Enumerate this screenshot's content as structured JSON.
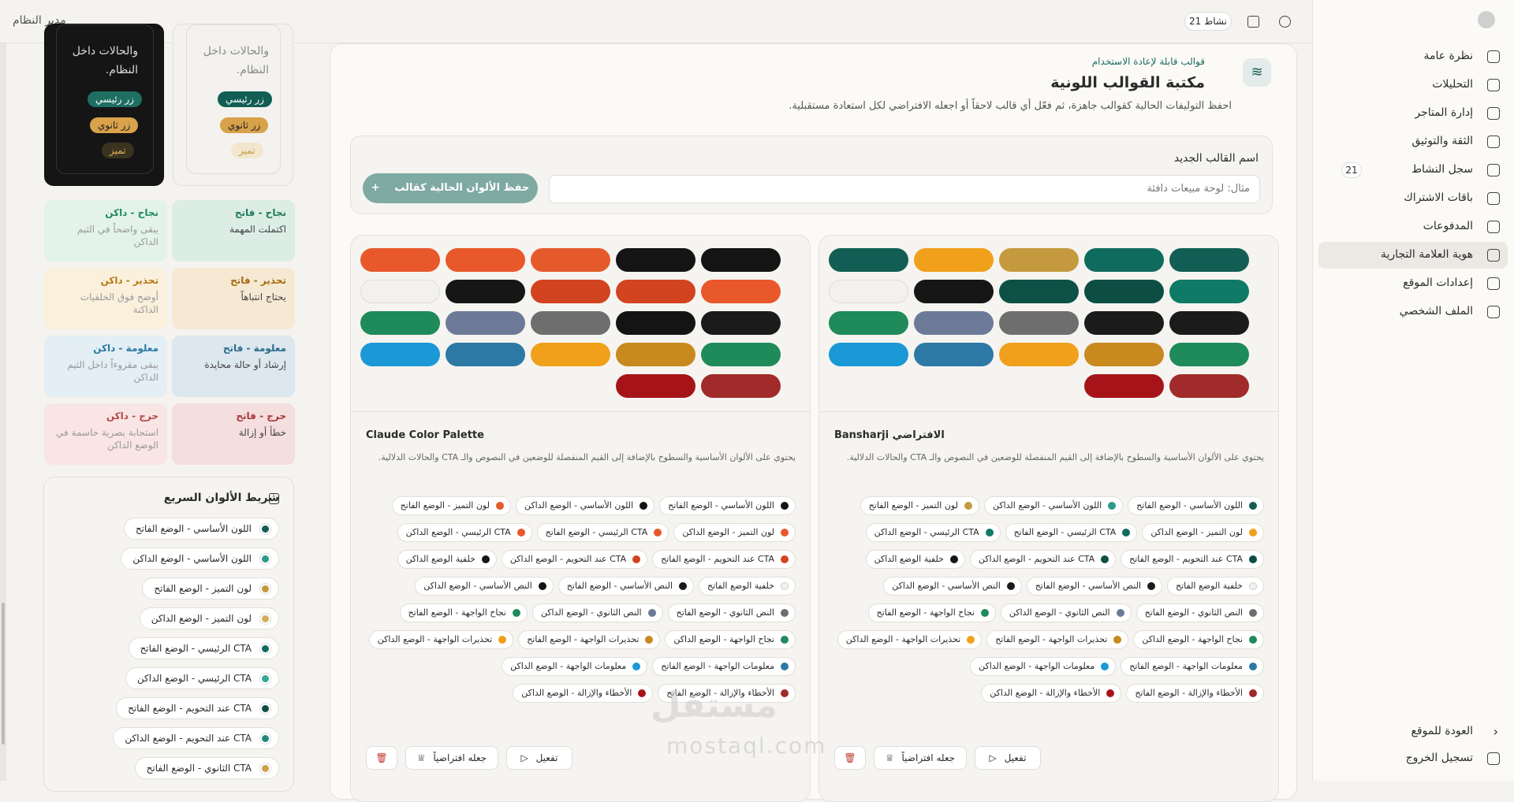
{
  "sidebar": {
    "items": [
      {
        "label": "نظرة عامة",
        "icon": "grid-icon"
      },
      {
        "label": "التحليلات",
        "icon": "chart-icon"
      },
      {
        "label": "إدارة المتاجر",
        "icon": "store-icon"
      },
      {
        "label": "الثقة والتوثيق",
        "icon": "shield-icon"
      },
      {
        "label": "سجل النشاط",
        "icon": "history-icon",
        "badge": "21"
      },
      {
        "label": "باقات الاشتراك",
        "icon": "card-icon"
      },
      {
        "label": "المدفوعات",
        "icon": "payments-icon"
      },
      {
        "label": "هوية العلامة التجارية",
        "icon": "gear-icon",
        "active": true
      },
      {
        "label": "إعدادات الموقع",
        "icon": "gear-icon"
      },
      {
        "label": "الملف الشخصي",
        "icon": "user-icon"
      }
    ],
    "back_label": "العودة للموقع",
    "logout_label": "تسجيل الخروج"
  },
  "topbar": {
    "title": "مدير النظام",
    "activity": "نشاط 21"
  },
  "preview": {
    "cards": [
      {
        "text": "والحالات داخل النظام.",
        "primary": "زر رئيسي",
        "secondary": "زر ثانوي",
        "accent": "تميز"
      },
      {
        "text": "والحالات داخل النظام.",
        "primary": "زر رئيسي",
        "secondary": "زر ثانوي",
        "accent": "تميز"
      }
    ],
    "tones": [
      {
        "title": "نجاح - فاتح",
        "desc": "اكتملت المهمة",
        "bg": "#dcede6",
        "color": "#1f7a5a"
      },
      {
        "title": "نجاح - داكن",
        "desc": "يبقى واضحاً في الثيم الداكن",
        "bg": "#e3f3ea",
        "color": "#1f8a5a"
      },
      {
        "title": "تحذير - فاتح",
        "desc": "يحتاج انتباهاً",
        "bg": "#f6e9d3",
        "color": "#a46b10"
      },
      {
        "title": "تحذير - داكن",
        "desc": "أوضح فوق الخلفيات الداكنة",
        "bg": "#fbf0dc",
        "color": "#b57a15"
      },
      {
        "title": "معلومة - فاتح",
        "desc": "إرشاد أو حالة محايدة",
        "bg": "#dce7ee",
        "color": "#2c6a8a"
      },
      {
        "title": "معلومة - داكن",
        "desc": "يبقى مقروءاً داخل الثيم الداكن",
        "bg": "#e3eef5",
        "color": "#2c7aa0"
      },
      {
        "title": "حرج - فاتح",
        "desc": "خطأ أو إزالة",
        "bg": "#f5dede",
        "color": "#a63a3a"
      },
      {
        "title": "حرج - داكن",
        "desc": "استجابة بصرية حاسمة في الوضع الداكن",
        "bg": "#f9e6e4",
        "color": "#b24a4a"
      }
    ],
    "quick_title": "شريط الألوان السريع",
    "quick_items": [
      {
        "label": "اللون الأساسي - الوضع الفاتح",
        "color": "#125e54"
      },
      {
        "label": "اللون الأساسي - الوضع الداكن",
        "color": "#2a9a8a"
      },
      {
        "label": "لون التميز - الوضع الفاتح",
        "color": "#c59a3e"
      },
      {
        "label": "لون التميز - الوضع الداكن",
        "color": "#d3ad58"
      },
      {
        "label": "CTA الرئيسي - الوضع الفاتح",
        "color": "#0f6b5e"
      },
      {
        "label": "CTA الرئيسي - الوضع الداكن",
        "color": "#35a896"
      },
      {
        "label": "CTA عند التحويم - الوضع الفاتح",
        "color": "#0c4d44"
      },
      {
        "label": "CTA عند التحويم - الوضع الداكن",
        "color": "#1f8a7a"
      },
      {
        "label": "CTA الثانوي - الوضع الفاتح",
        "color": "#c9a24a"
      }
    ]
  },
  "library": {
    "eyebrow": "قوالب قابلة لإعادة الاستخدام",
    "title": "مكتبة القوالب اللونية",
    "desc": "احفظ التوليفات الحالية كقوالب جاهزة، ثم فعّل أي قالب لاحقاً أو اجعله الافتراضي لكل استعادة مستقبلية.",
    "new_label": "اسم القالب الجديد",
    "new_placeholder": "مثال: لوحة مبيعات دافئة",
    "save_label": "حفظ الألوان الحالية كقالب"
  },
  "templates": [
    {
      "name": "Bansharji الافتراضي",
      "desc": "يحتوي على الألوان الأساسية والسطوح بالإضافة إلى القيم المنفصلة للوضعين في النصوص والـ CTA والحالات الدلالية.",
      "swatches": [
        "#125e54",
        "#0f6b5e",
        "#c59a3e",
        "#f0a01a",
        "#125e54",
        "#0f7a66",
        "#0c4d44",
        "#0d5046",
        "#161616",
        "#f2f1ed",
        "#1b1b1b",
        "#1b1b1b",
        "#6e6e6e",
        "#6c7a98",
        "#1f8a5a",
        "#1f8a5a",
        "#c8891f",
        "#f0a01a",
        "#2c79a5",
        "#1b98d6",
        "#a12a2a",
        "#a6141a"
      ],
      "chips": [
        {
          "label": "اللون الأساسي - الوضع الفاتح",
          "color": "#125e54"
        },
        {
          "label": "اللون الأساسي - الوضع الداكن",
          "color": "#2a9a8a"
        },
        {
          "label": "لون التميز - الوضع الفاتح",
          "color": "#c59a3e"
        },
        {
          "label": "لون التميز - الوضع الداكن",
          "color": "#f0a01a"
        },
        {
          "label": "CTA الرئيسي - الوضع الفاتح",
          "color": "#0f6b5e"
        },
        {
          "label": "CTA الرئيسي - الوضع الداكن",
          "color": "#0f7a66"
        },
        {
          "label": "CTA عند التحويم - الوضع الفاتح",
          "color": "#0c4d44"
        },
        {
          "label": "CTA عند التحويم - الوضع الداكن",
          "color": "#0d5046"
        },
        {
          "label": "خلفية الوضع الداكن",
          "color": "#161616"
        },
        {
          "label": "خلفية الوضع الفاتح",
          "color": "#f2f1ed"
        },
        {
          "label": "النص الأساسي - الوضع الفاتح",
          "color": "#1b1b1b"
        },
        {
          "label": "النص الأساسي - الوضع الداكن",
          "color": "#1b1b1b"
        },
        {
          "label": "النص الثانوي - الوضع الفاتح",
          "color": "#6e6e6e"
        },
        {
          "label": "النص الثانوي - الوضع الداكن",
          "color": "#6c7a98"
        },
        {
          "label": "نجاح الواجهة - الوضع الفاتح",
          "color": "#1f8a5a"
        },
        {
          "label": "نجاح الواجهة - الوضع الداكن",
          "color": "#1f8a5a"
        },
        {
          "label": "تحذيرات الواجهة - الوضع الفاتح",
          "color": "#c8891f"
        },
        {
          "label": "تحذيرات الواجهة - الوضع الداكن",
          "color": "#f0a01a"
        },
        {
          "label": "معلومات الواجهة - الوضع الفاتح",
          "color": "#2c79a5"
        },
        {
          "label": "معلومات الواجهة - الوضع الداكن",
          "color": "#1b98d6"
        },
        {
          "label": "الأخطاء والإزالة - الوضع الفاتح",
          "color": "#a12a2a"
        },
        {
          "label": "الأخطاء والإزالة - الوضع الداكن",
          "color": "#a6141a"
        }
      ],
      "activate": "تفعيل",
      "default": "جعله افتراضياً"
    },
    {
      "name": "Claude Color Palette",
      "desc": "يحتوي على الألوان الأساسية والسطوح بالإضافة إلى القيم المنفصلة للوضعين في النصوص والـ CTA والحالات الدلالية.",
      "swatches": [
        "#141414",
        "#141414",
        "#e55a2b",
        "#e8582a",
        "#e8582a",
        "#e8582a",
        "#d2441f",
        "#d2441f",
        "#161616",
        "#f2f1ed",
        "#1b1b1b",
        "#141414",
        "#6e6e6e",
        "#6c7a98",
        "#1f8a5a",
        "#1f8a5a",
        "#c8891f",
        "#f0a01a",
        "#2c79a5",
        "#1b98d6",
        "#a12a2a",
        "#a6141a"
      ],
      "chips": [
        {
          "label": "اللون الأساسي - الوضع الفاتح",
          "color": "#141414"
        },
        {
          "label": "اللون الأساسي - الوضع الداكن",
          "color": "#141414"
        },
        {
          "label": "لون التميز - الوضع الفاتح",
          "color": "#e55a2b"
        },
        {
          "label": "لون التميز - الوضع الداكن",
          "color": "#e8582a"
        },
        {
          "label": "CTA الرئيسي - الوضع الفاتح",
          "color": "#e8582a"
        },
        {
          "label": "CTA الرئيسي - الوضع الداكن",
          "color": "#e8582a"
        },
        {
          "label": "CTA عند التحويم - الوضع الفاتح",
          "color": "#d2441f"
        },
        {
          "label": "CTA عند التحويم - الوضع الداكن",
          "color": "#d2441f"
        },
        {
          "label": "خلفية الوضع الداكن",
          "color": "#161616"
        },
        {
          "label": "خلفية الوضع الفاتح",
          "color": "#f2f1ed"
        },
        {
          "label": "النص الأساسي - الوضع الفاتح",
          "color": "#1b1b1b"
        },
        {
          "label": "النص الأساسي - الوضع الداكن",
          "color": "#141414"
        },
        {
          "label": "النص الثانوي - الوضع الفاتح",
          "color": "#6e6e6e"
        },
        {
          "label": "النص الثانوي - الوضع الداكن",
          "color": "#6c7a98"
        },
        {
          "label": "نجاح الواجهة - الوضع الفاتح",
          "color": "#1f8a5a"
        },
        {
          "label": "نجاح الواجهة - الوضع الداكن",
          "color": "#1f8a5a"
        },
        {
          "label": "تحذيرات الواجهة - الوضع الفاتح",
          "color": "#c8891f"
        },
        {
          "label": "تحذيرات الواجهة - الوضع الداكن",
          "color": "#f0a01a"
        },
        {
          "label": "معلومات الواجهة - الوضع الفاتح",
          "color": "#2c79a5"
        },
        {
          "label": "معلومات الواجهة - الوضع الداكن",
          "color": "#1b98d6"
        },
        {
          "label": "الأخطاء والإزالة - الوضع الفاتح",
          "color": "#a12a2a"
        },
        {
          "label": "الأخطاء والإزالة - الوضع الداكن",
          "color": "#a6141a"
        }
      ],
      "activate": "تفعيل",
      "default": "جعله افتراضياً"
    }
  ],
  "watermark": {
    "arabic": "مستقل",
    "latin": "mostaql.com"
  }
}
